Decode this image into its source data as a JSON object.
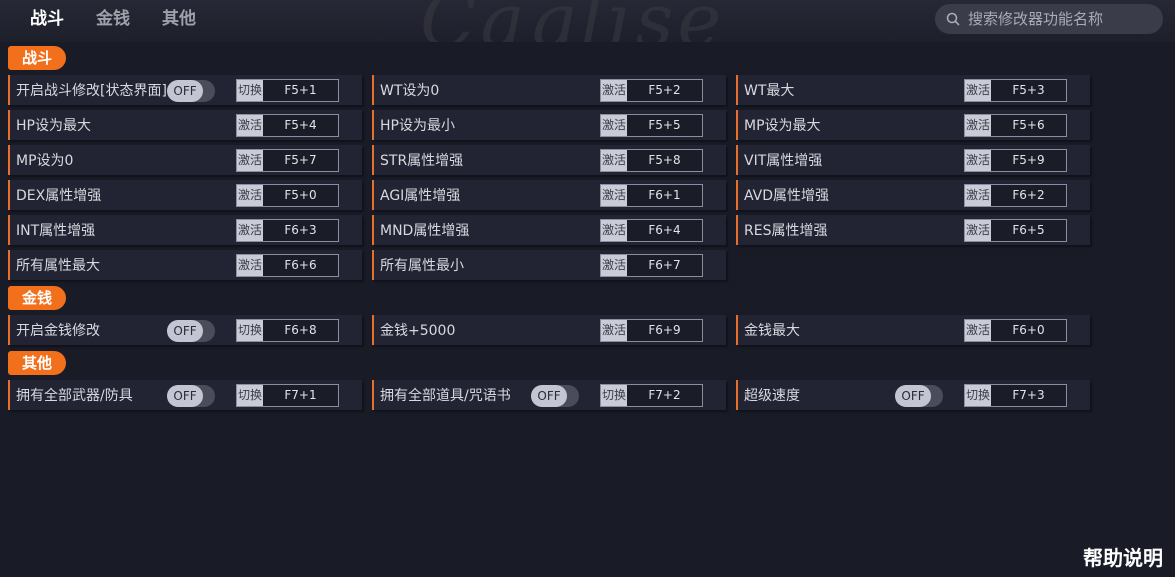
{
  "header": {
    "tabs": [
      "战斗",
      "金钱",
      "其他"
    ],
    "search": {
      "placeholder": "搜索修改器功能名称",
      "icon": "search-icon"
    },
    "decor_text": "Caglise"
  },
  "sections": [
    {
      "title": "战斗",
      "items": [
        {
          "label": "开启战斗修改[状态界面]",
          "toggle": "OFF",
          "action": "切换",
          "key": "F5+1"
        },
        {
          "label": "WT设为0",
          "action": "激活",
          "key": "F5+2"
        },
        {
          "label": "WT最大",
          "action": "激活",
          "key": "F5+3"
        },
        {
          "label": "HP设为最大",
          "action": "激活",
          "key": "F5+4"
        },
        {
          "label": "HP设为最小",
          "action": "激活",
          "key": "F5+5"
        },
        {
          "label": "MP设为最大",
          "action": "激活",
          "key": "F5+6"
        },
        {
          "label": "MP设为0",
          "action": "激活",
          "key": "F5+7"
        },
        {
          "label": "STR属性增强",
          "action": "激活",
          "key": "F5+8"
        },
        {
          "label": "VIT属性增强",
          "action": "激活",
          "key": "F5+9"
        },
        {
          "label": "DEX属性增强",
          "action": "激活",
          "key": "F5+0"
        },
        {
          "label": "AGI属性增强",
          "action": "激活",
          "key": "F6+1"
        },
        {
          "label": "AVD属性增强",
          "action": "激活",
          "key": "F6+2"
        },
        {
          "label": "INT属性增强",
          "action": "激活",
          "key": "F6+3"
        },
        {
          "label": "MND属性增强",
          "action": "激活",
          "key": "F6+4"
        },
        {
          "label": "RES属性增强",
          "action": "激活",
          "key": "F6+5"
        },
        {
          "label": "所有属性最大",
          "action": "激活",
          "key": "F6+6"
        },
        {
          "label": "所有属性最小",
          "action": "激活",
          "key": "F6+7"
        }
      ]
    },
    {
      "title": "金钱",
      "items": [
        {
          "label": "开启金钱修改",
          "toggle": "OFF",
          "action": "切换",
          "key": "F6+8"
        },
        {
          "label": "金钱+5000",
          "action": "激活",
          "key": "F6+9"
        },
        {
          "label": "金钱最大",
          "action": "激活",
          "key": "F6+0"
        }
      ]
    },
    {
      "title": "其他",
      "items": [
        {
          "label": "拥有全部武器/防具",
          "toggle": "OFF",
          "action": "切换",
          "key": "F7+1"
        },
        {
          "label": "拥有全部道具/咒语书",
          "toggle": "OFF",
          "action": "切换",
          "key": "F7+2"
        },
        {
          "label": "超级速度",
          "toggle": "OFF",
          "action": "切换",
          "key": "F7+3"
        }
      ]
    }
  ],
  "help_label": "帮助说明",
  "colors": {
    "background": "#191b27",
    "accent": "#f2701c",
    "item_bg": "#222433",
    "toggle_knob": "#c3c5d3"
  }
}
